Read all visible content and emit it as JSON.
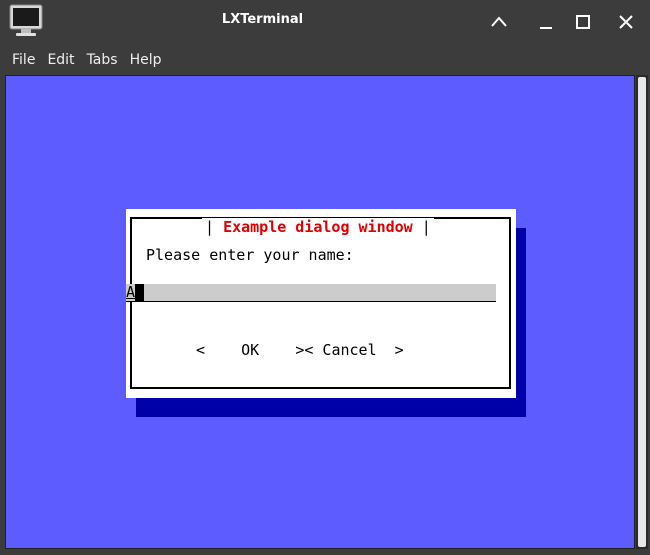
{
  "window": {
    "title": "LXTerminal",
    "icon": "terminal-monitor-icon"
  },
  "wm_buttons": {
    "minimize_icon": "chevron-up-icon",
    "maximize_icon": "minus-icon",
    "restore_icon": "square-icon",
    "close_icon": "close-icon"
  },
  "menu": {
    "items": [
      "File",
      "Edit",
      "Tabs",
      "Help"
    ]
  },
  "terminal": {
    "background": "#5d5dff",
    "dialog": {
      "title_left": "| ",
      "title": "Example dialog window",
      "title_right": " |",
      "prompt": "Please enter your name:",
      "input_value": "A",
      "ok_label": "<    OK    >",
      "cancel_label": "< Cancel  >"
    }
  },
  "colors": {
    "dialog_title": "#e00000",
    "dialog_shadow": "#0000a8",
    "input_background": "#cccccc"
  }
}
